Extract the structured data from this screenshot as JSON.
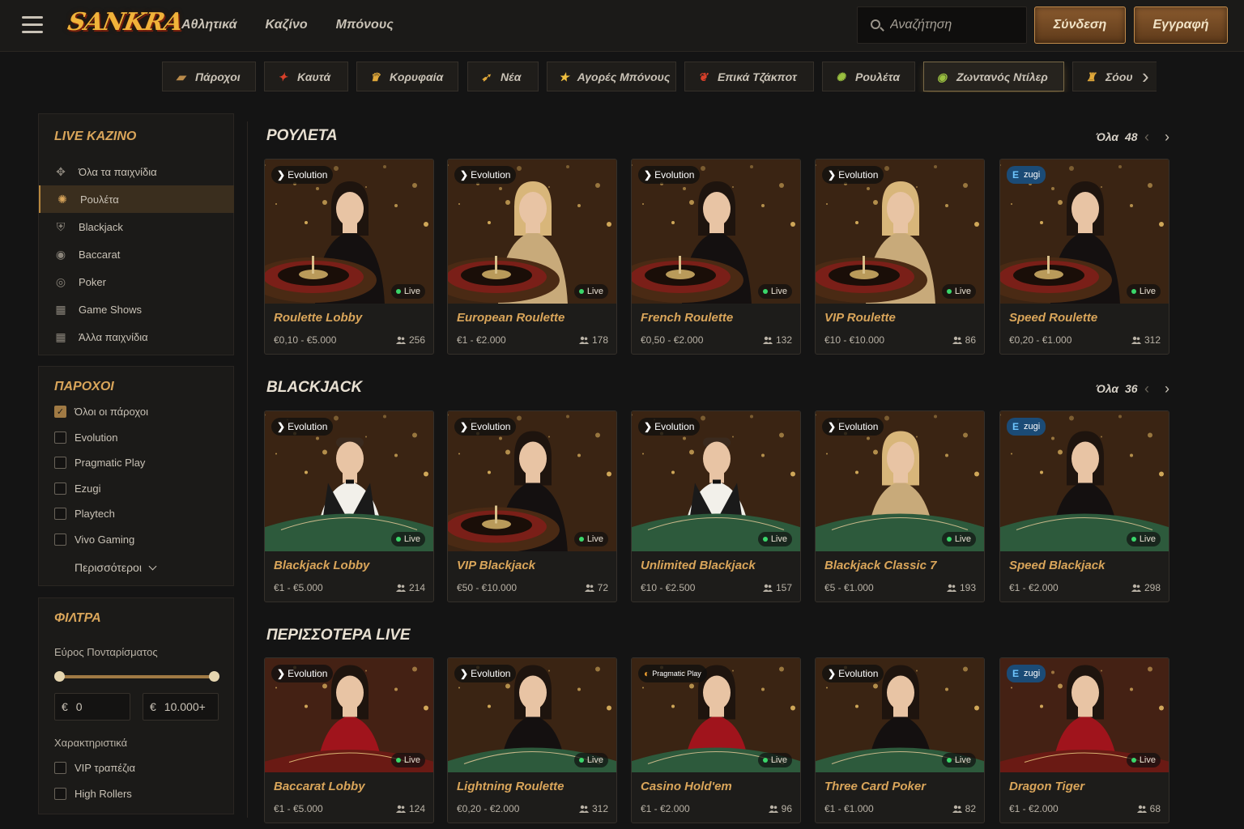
{
  "header": {
    "logo": "SANKRA",
    "nav": [
      "Αθλητικά",
      "Καζίνο",
      "Μπόνους"
    ],
    "search_placeholder": "Αναζήτηση",
    "login": "Σύνδεση",
    "register": "Εγγραφή"
  },
  "categories": [
    {
      "label": "Πάροχοι",
      "icon": "book-icon"
    },
    {
      "label": "Καυτά",
      "icon": "chili-icon"
    },
    {
      "label": "Κορυφαία",
      "icon": "crown-icon"
    },
    {
      "label": "Νέα",
      "icon": "horn-icon"
    },
    {
      "label": "Αγορές Μπόνους",
      "icon": "star-icon"
    },
    {
      "label": "Επικά Τζάκποτ",
      "icon": "pepper-icon"
    },
    {
      "label": "Ρουλέτα",
      "icon": "roulette-icon"
    },
    {
      "label": "Ζωντανός Ντίλερ",
      "icon": "chip-icon",
      "active": true
    },
    {
      "label": "Σόου",
      "icon": "trophy-icon"
    }
  ],
  "sidebar": {
    "live_title": "LIVE ΚΑΖΙΝΟ",
    "live_items": [
      {
        "label": "Όλα τα παιχνίδια",
        "icon": "gamepad-icon"
      },
      {
        "label": "Ρουλέτα",
        "icon": "roulette-icon",
        "active": true
      },
      {
        "label": "Blackjack",
        "icon": "shield-icon"
      },
      {
        "label": "Baccarat",
        "icon": "chip-icon"
      },
      {
        "label": "Poker",
        "icon": "poker-chip-icon"
      },
      {
        "label": "Game Shows",
        "icon": "building-icon"
      },
      {
        "label": "Άλλα παιχνίδια",
        "icon": "building-icon"
      }
    ],
    "providers_title": "ΠΑΡΟΧΟΙ",
    "providers": [
      {
        "label": "Όλοι οι πάροχοι",
        "checked": true
      },
      {
        "label": "Evolution",
        "checked": false
      },
      {
        "label": "Pragmatic Play",
        "checked": false
      },
      {
        "label": "Ezugi",
        "checked": false
      },
      {
        "label": "Playtech",
        "checked": false
      },
      {
        "label": "Vivo Gaming",
        "checked": false
      }
    ],
    "providers_more": "Περισσότεροι",
    "filters_title": "ΦΙΛΤΡΑ",
    "bet_range_label": "Εύρος Πονταρίσματος",
    "currency": "€",
    "min": "0",
    "max": "10.000+",
    "features_label": "Χαρακτηριστικά",
    "features": [
      {
        "label": "VIP τραπέζια",
        "checked": false
      },
      {
        "label": "High Rollers",
        "checked": false
      }
    ]
  },
  "sections": [
    {
      "title": "ΡΟΥΛΕΤΑ",
      "all_label": "Όλα",
      "count": "48",
      "games": [
        {
          "name": "Roulette Lobby",
          "provider": "Evolution",
          "bet": "€0,10 - €5.000",
          "players": "256",
          "scene": "roulette",
          "dealer": "dark"
        },
        {
          "name": "European Roulette",
          "provider": "Evolution",
          "bet": "€1 - €2.000",
          "players": "178",
          "scene": "roulette",
          "dealer": "blonde"
        },
        {
          "name": "French Roulette",
          "provider": "Evolution",
          "bet": "€0,50 - €2.000",
          "players": "132",
          "scene": "roulette",
          "dealer": "dark"
        },
        {
          "name": "VIP Roulette",
          "provider": "Evolution",
          "bet": "€10 - €10.000",
          "players": "86",
          "scene": "roulette",
          "dealer": "blonde"
        },
        {
          "name": "Speed Roulette",
          "provider": "Ezugi",
          "bet": "€0,20 - €1.000",
          "players": "312",
          "scene": "roulette",
          "dealer": "dark"
        }
      ]
    },
    {
      "title": "BLACKJACK",
      "all_label": "Όλα",
      "count": "36",
      "games": [
        {
          "name": "Blackjack Lobby",
          "provider": "Evolution",
          "bet": "€1 - €5.000",
          "players": "214",
          "scene": "felt",
          "dealer": "male"
        },
        {
          "name": "VIP Blackjack",
          "provider": "Evolution",
          "bet": "€50 - €10.000",
          "players": "72",
          "scene": "roulette",
          "dealer": "dark"
        },
        {
          "name": "Unlimited Blackjack",
          "provider": "Evolution",
          "bet": "€10 - €2.500",
          "players": "157",
          "scene": "felt",
          "dealer": "male"
        },
        {
          "name": "Blackjack Classic 7",
          "provider": "Evolution",
          "bet": "€5 - €1.000",
          "players": "193",
          "scene": "felt",
          "dealer": "blonde"
        },
        {
          "name": "Speed Blackjack",
          "provider": "Ezugi",
          "bet": "€1 - €2.000",
          "players": "298",
          "scene": "felt",
          "dealer": "dark"
        }
      ]
    },
    {
      "title": "ΠΕΡΙΣΣΟΤΕΡΑ LIVE",
      "all_label": "",
      "count": "",
      "games": [
        {
          "name": "Baccarat Lobby",
          "provider": "Evolution",
          "bet": "€1 - €5.000",
          "players": "124",
          "scene": "red",
          "dealer": "red"
        },
        {
          "name": "Lightning Roulette",
          "provider": "Evolution",
          "bet": "€0,20 - €2.000",
          "players": "312",
          "scene": "felt",
          "dealer": "dark"
        },
        {
          "name": "Casino Hold'em",
          "provider": "Pragmatic Play",
          "bet": "€1 - €2.000",
          "players": "96",
          "scene": "felt",
          "dealer": "red"
        },
        {
          "name": "Three Card Poker",
          "provider": "Evolution",
          "bet": "€1 - €1.000",
          "players": "82",
          "scene": "felt",
          "dealer": "dark"
        },
        {
          "name": "Dragon Tiger",
          "provider": "Ezugi",
          "bet": "€1 - €2.000",
          "players": "68",
          "scene": "red",
          "dealer": "red"
        }
      ]
    }
  ]
}
